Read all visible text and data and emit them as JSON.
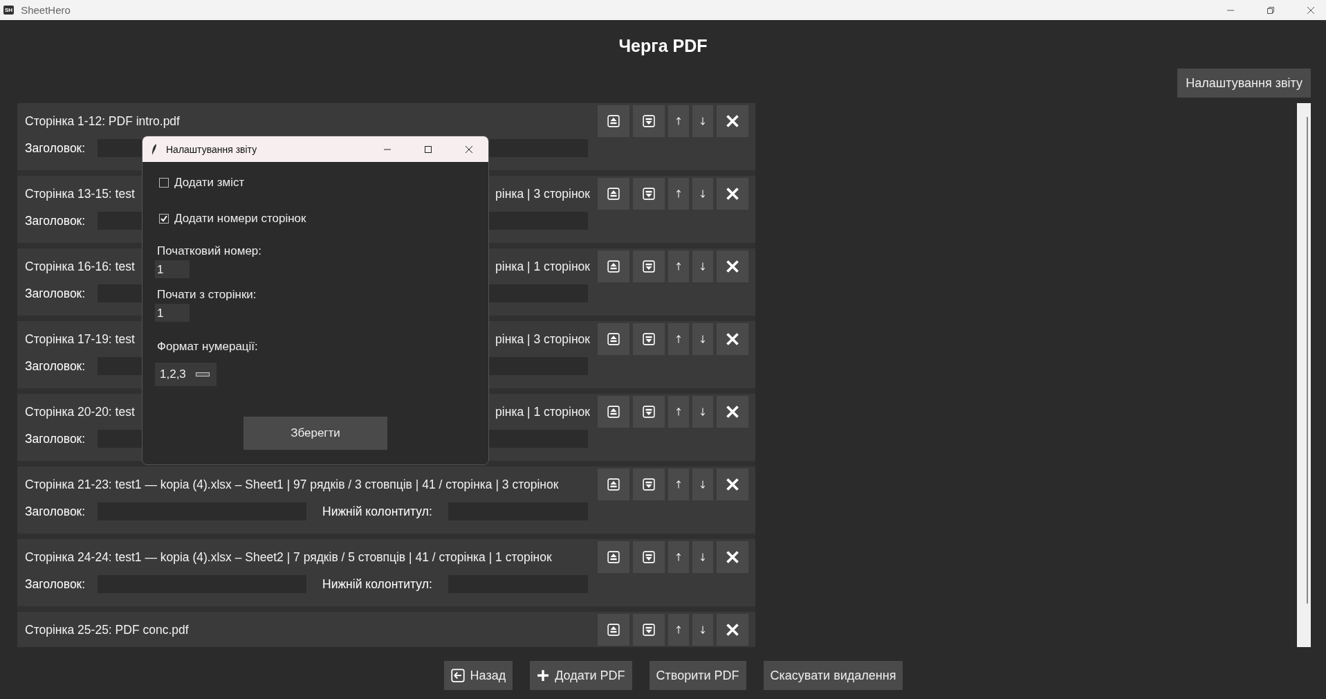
{
  "window": {
    "title": "SheetHero",
    "app_icon": "SH"
  },
  "heading": "Черга PDF",
  "report_settings_button": "Налаштування звіту",
  "rows": [
    {
      "title": "Сторінка 1-12: PDF intro.pdf",
      "header_label": "Заголовок:"
    },
    {
      "title": "Сторінка 13-15: test",
      "title_tail": "рінка | 3 сторінок",
      "header_label": "Заголовок:"
    },
    {
      "title": "Сторінка 16-16: test",
      "title_tail": "рінка | 1 сторінок",
      "header_label": "Заголовок:"
    },
    {
      "title": "Сторінка 17-19: test",
      "title_tail": "рінка | 3 сторінок",
      "header_label": "Заголовок:"
    },
    {
      "title": "Сторінка 20-20: test",
      "title_tail": "рінка | 1 сторінок",
      "header_label": "Заголовок:"
    },
    {
      "title": "Сторінка 21-23: test1 — kopia (4).xlsx – Sheet1 | 97 рядків / 3 стовпців | 41 / сторінка | 3 сторінок",
      "header_label": "Заголовок:",
      "footer_label": "Нижній колонтитул:"
    },
    {
      "title": "Сторінка 24-24: test1 — kopia (4).xlsx – Sheet2 | 7 рядків / 5 стовпців | 41 / сторінка | 1 сторінок",
      "header_label": "Заголовок:",
      "footer_label": "Нижній колонтитул:"
    },
    {
      "title": "Сторінка 25-25: PDF conc.pdf"
    }
  ],
  "dialog": {
    "title": "Налаштування звіту",
    "checkboxes": [
      {
        "label": "Додати зміст",
        "checked": false
      },
      {
        "label": "Додати номери сторінок",
        "checked": true
      }
    ],
    "fields": [
      {
        "label": "Початковий номер:",
        "value": "1"
      },
      {
        "label": "Почати з сторінки:",
        "value": "1"
      }
    ],
    "format": {
      "label": "Формат нумерації:",
      "value": "1,2,3"
    },
    "save_button": "Зберегти"
  },
  "bottom_buttons": [
    {
      "kind": "back",
      "label": "Назад"
    },
    {
      "kind": "add",
      "label": "Додати PDF"
    },
    {
      "kind": "plain",
      "label": "Створити PDF"
    },
    {
      "kind": "plain",
      "label": "Скасувати видалення"
    }
  ]
}
